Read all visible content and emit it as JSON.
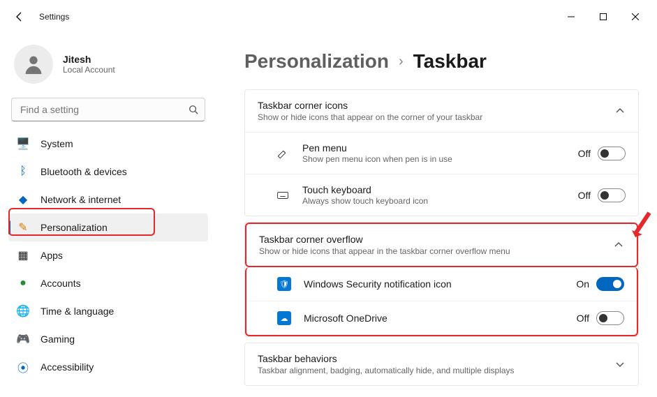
{
  "app": {
    "title": "Settings"
  },
  "profile": {
    "name": "Jitesh",
    "type": "Local Account"
  },
  "search": {
    "placeholder": "Find a setting"
  },
  "sidebar": {
    "items": [
      {
        "label": "System"
      },
      {
        "label": "Bluetooth & devices"
      },
      {
        "label": "Network & internet"
      },
      {
        "label": "Personalization"
      },
      {
        "label": "Apps"
      },
      {
        "label": "Accounts"
      },
      {
        "label": "Time & language"
      },
      {
        "label": "Gaming"
      },
      {
        "label": "Accessibility"
      }
    ]
  },
  "breadcrumb": {
    "parent": "Personalization",
    "current": "Taskbar"
  },
  "sections": [
    {
      "title": "Taskbar corner icons",
      "desc": "Show or hide icons that appear on the corner of your taskbar",
      "expanded": true,
      "rows": [
        {
          "title": "Pen menu",
          "desc": "Show pen menu icon when pen is in use",
          "state": "Off",
          "on": false
        },
        {
          "title": "Touch keyboard",
          "desc": "Always show touch keyboard icon",
          "state": "Off",
          "on": false
        }
      ]
    },
    {
      "title": "Taskbar corner overflow",
      "desc": "Show or hide icons that appear in the taskbar corner overflow menu",
      "expanded": true,
      "rows": [
        {
          "title": "Windows Security notification icon",
          "state": "On",
          "on": true
        },
        {
          "title": "Microsoft OneDrive",
          "state": "Off",
          "on": false
        }
      ]
    },
    {
      "title": "Taskbar behaviors",
      "desc": "Taskbar alignment, badging, automatically hide, and multiple displays",
      "expanded": false
    }
  ]
}
